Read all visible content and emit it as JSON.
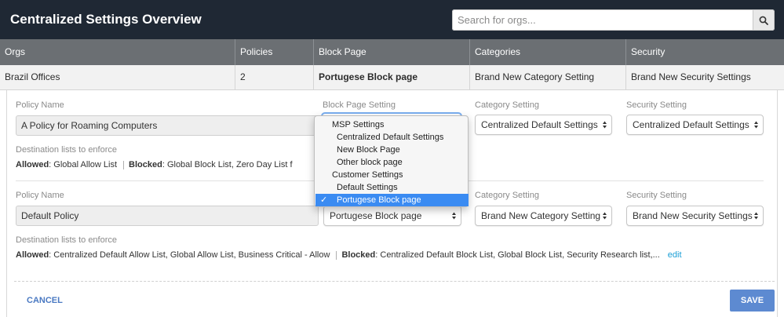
{
  "header": {
    "title": "Centralized Settings Overview",
    "search_placeholder": "Search for orgs...",
    "search_icon": "search-icon"
  },
  "table": {
    "columns": [
      "Orgs",
      "Policies",
      "Block Page",
      "Categories",
      "Security"
    ],
    "row": {
      "org": "Brazil Offices",
      "policies": "2",
      "block_page": "Portugese Block page",
      "categories": "Brand New Category Setting",
      "security": "Brand New Security Settings"
    }
  },
  "labels": {
    "policy_name": "Policy Name",
    "block_page_setting": "Block Page Setting",
    "category_setting": "Category Setting",
    "security_setting": "Security Setting",
    "destination_lists": "Destination lists to enforce",
    "allowed": "Allowed",
    "blocked": "Blocked"
  },
  "policies": [
    {
      "name": "A Policy for Roaming Computers",
      "block_page": "Portugese Block page",
      "category": "Centralized Default Settings",
      "security": "Centralized Default Settings",
      "allowed": "Global Allow List",
      "blocked": "Global Block List, Zero Day List f"
    },
    {
      "name": "Default Policy",
      "block_page": "Portugese Block page",
      "category": "Brand New Category Setting",
      "security": "Brand New Security Settings",
      "allowed": "Centralized Default Allow List, Global Allow List, Business Critical - Allow",
      "blocked": "Centralized Default Block List, Global Block List, Security Research list,...",
      "edit_label": "edit"
    }
  ],
  "dropdown": {
    "items": [
      {
        "label": "MSP Settings",
        "kind": "group"
      },
      {
        "label": "Centralized Default Settings",
        "kind": "option"
      },
      {
        "label": "New Block Page",
        "kind": "option"
      },
      {
        "label": "Other block page",
        "kind": "option"
      },
      {
        "label": "Customer Settings",
        "kind": "group"
      },
      {
        "label": "Default Settings",
        "kind": "option"
      },
      {
        "label": "Portugese Block page",
        "kind": "option",
        "selected": true
      }
    ],
    "check_mark": "✓"
  },
  "footer": {
    "cancel_label": "CANCEL",
    "save_label": "SAVE"
  },
  "colors": {
    "topbar": "#1f2834",
    "table_header": "#6b6f73",
    "accent_blue": "#5d8ad1",
    "link": "#1a9fd6",
    "selected_item": "#3a8bf2"
  }
}
